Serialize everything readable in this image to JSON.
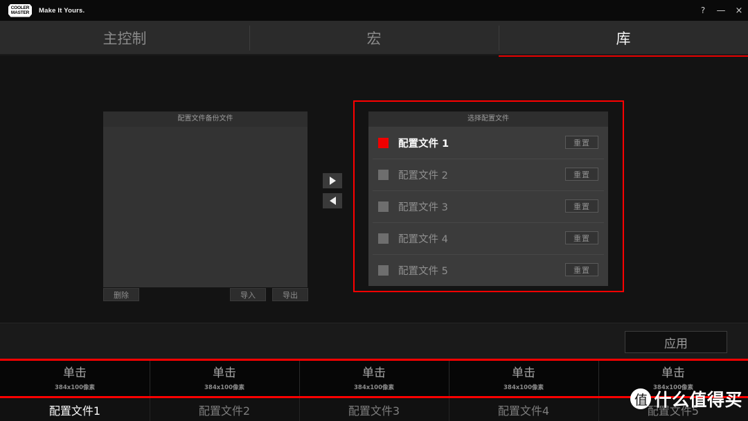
{
  "window": {
    "brand_line1": "COOLER",
    "brand_line2": "MASTER",
    "tagline": "Make It Yours.",
    "controls": {
      "help": "?",
      "minimize": "—",
      "close": "×"
    }
  },
  "tabs": [
    {
      "label": "主控制",
      "active": false
    },
    {
      "label": "宏",
      "active": false
    },
    {
      "label": "库",
      "active": true
    }
  ],
  "backup_panel": {
    "title": "配置文件备份文件",
    "items": [],
    "delete_label": "删除",
    "import_label": "导入",
    "export_label": "导出"
  },
  "transfer": {
    "to_right_icon": "triangle-right-icon",
    "to_left_icon": "triangle-left-icon"
  },
  "profile_panel": {
    "title": "选择配置文件",
    "reset_label": "重置",
    "rows": [
      {
        "label": "配置文件 1",
        "active": true,
        "swatch": "#f00000"
      },
      {
        "label": "配置文件 2",
        "active": false,
        "swatch": "#6e6e6e"
      },
      {
        "label": "配置文件 3",
        "active": false,
        "swatch": "#6e6e6e"
      },
      {
        "label": "配置文件 4",
        "active": false,
        "swatch": "#6e6e6e"
      },
      {
        "label": "配置文件 5",
        "active": false,
        "swatch": "#6e6e6e"
      }
    ]
  },
  "apply": {
    "label": "应用"
  },
  "preview_strip": {
    "cells": [
      {
        "click_label": "单击",
        "dimensions": "384x100像素"
      },
      {
        "click_label": "单击",
        "dimensions": "384x100像素"
      },
      {
        "click_label": "单击",
        "dimensions": "384x100像素"
      },
      {
        "click_label": "单击",
        "dimensions": "384x100像素"
      },
      {
        "click_label": "单击",
        "dimensions": "384x100像素"
      }
    ]
  },
  "profile_labels": [
    {
      "label": "配置文件1",
      "active": true
    },
    {
      "label": "配置文件2",
      "active": false
    },
    {
      "label": "配置文件3",
      "active": false
    },
    {
      "label": "配置文件4",
      "active": false
    },
    {
      "label": "配置文件5",
      "active": false
    }
  ],
  "watermark": {
    "mark": "值",
    "text": "什么值得买"
  },
  "accent": {
    "red": "#ff0000",
    "active_red": "#e80000"
  }
}
